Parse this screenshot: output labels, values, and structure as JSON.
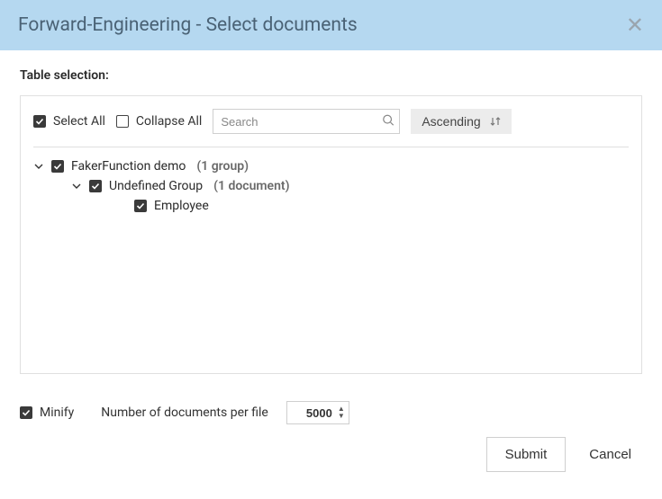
{
  "header": {
    "title": "Forward-Engineering - Select documents"
  },
  "section": {
    "label": "Table selection:"
  },
  "toolbar": {
    "select_all": {
      "label": "Select All",
      "checked": true
    },
    "collapse_all": {
      "label": "Collapse All",
      "checked": false
    },
    "search_placeholder": "Search",
    "sort_label": "Ascending"
  },
  "tree": {
    "root": {
      "label": "FakerFunction demo",
      "count_text": "(1 group)",
      "checked": true,
      "expanded": true
    },
    "group": {
      "label": "Undefined Group",
      "count_text": "(1 document)",
      "checked": true,
      "expanded": true
    },
    "doc": {
      "label": "Employee",
      "checked": true
    }
  },
  "footer": {
    "minify": {
      "label": "Minify",
      "checked": true
    },
    "per_file_label": "Number of documents per file",
    "per_file_value": "5000",
    "submit_label": "Submit",
    "cancel_label": "Cancel"
  }
}
